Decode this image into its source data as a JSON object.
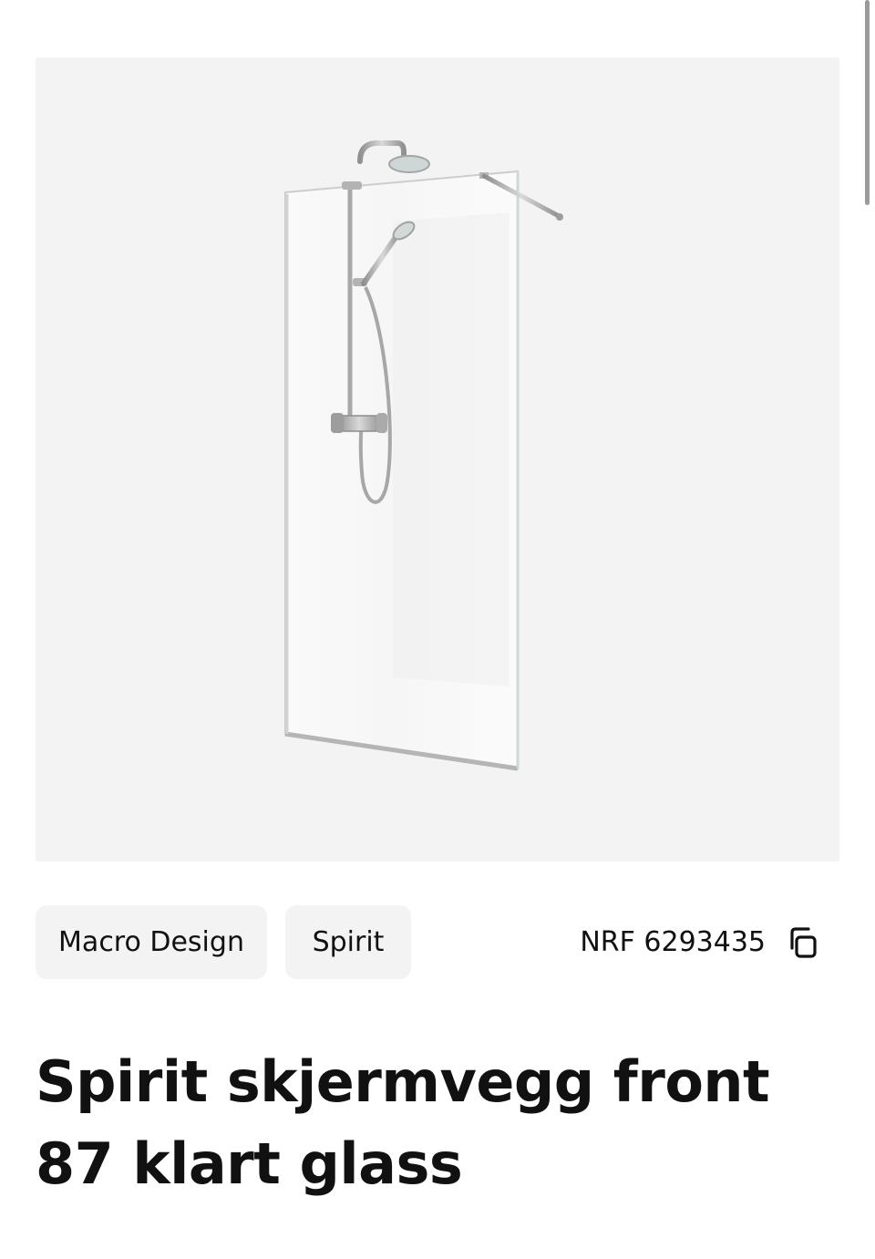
{
  "product": {
    "image_alt": "Spirit skjermvegg front 87 klart glass",
    "brand_tag": "Macro Design",
    "series_tag": "Spirit",
    "nrf_label": "NRF 6293435",
    "copy_icon": "copy-icon",
    "title": "Spirit skjermvegg front 87 klart glass"
  },
  "colors": {
    "image_background": "#f3f3f3",
    "tag_background": "#f3f3f3",
    "text": "#111111"
  }
}
